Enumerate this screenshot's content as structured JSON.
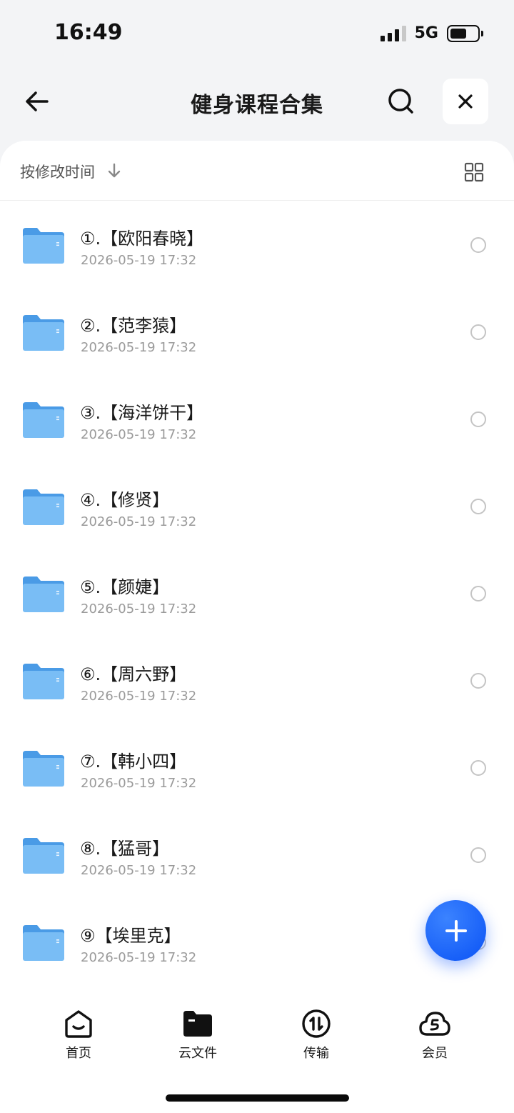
{
  "status_bar": {
    "time": "16:49",
    "network": "5G"
  },
  "header": {
    "title": "健身课程合集",
    "back_icon": "arrow-left-icon",
    "search_icon": "search-icon",
    "close_icon": "close-icon"
  },
  "sort_bar": {
    "label": "按修改时间",
    "sort_icon": "arrow-down-icon",
    "view_icon": "grid-view-icon"
  },
  "files": [
    {
      "name": "①.【欧阳春晓】",
      "date": "2026-05-19 17:32"
    },
    {
      "name": "②.【范李猿】",
      "date": "2026-05-19 17:32"
    },
    {
      "name": "③.【海洋饼干】",
      "date": "2026-05-19 17:32"
    },
    {
      "name": "④.【修贤】",
      "date": "2026-05-19 17:32"
    },
    {
      "name": "⑤.【颜婕】",
      "date": "2026-05-19 17:32"
    },
    {
      "name": "⑥.【周六野】",
      "date": "2026-05-19 17:32"
    },
    {
      "name": "⑦.【韩小四】",
      "date": "2026-05-19 17:32"
    },
    {
      "name": "⑧.【猛哥】",
      "date": "2026-05-19 17:32"
    },
    {
      "name": "⑨【埃里克】",
      "date": "2026-05-19 17:32"
    }
  ],
  "fab": {
    "icon": "plus-icon"
  },
  "tab_bar": {
    "items": [
      {
        "label": "首页",
        "icon": "home-icon"
      },
      {
        "label": "云文件",
        "icon": "folder-icon"
      },
      {
        "label": "传输",
        "icon": "transfer-icon"
      },
      {
        "label": "会员",
        "icon": "vip-cloud-icon"
      }
    ]
  },
  "colors": {
    "accent": "#0a52f5",
    "folder": "#6ab5f3",
    "background": "#f3f4f6",
    "secondary_text": "#9a9a9a"
  }
}
